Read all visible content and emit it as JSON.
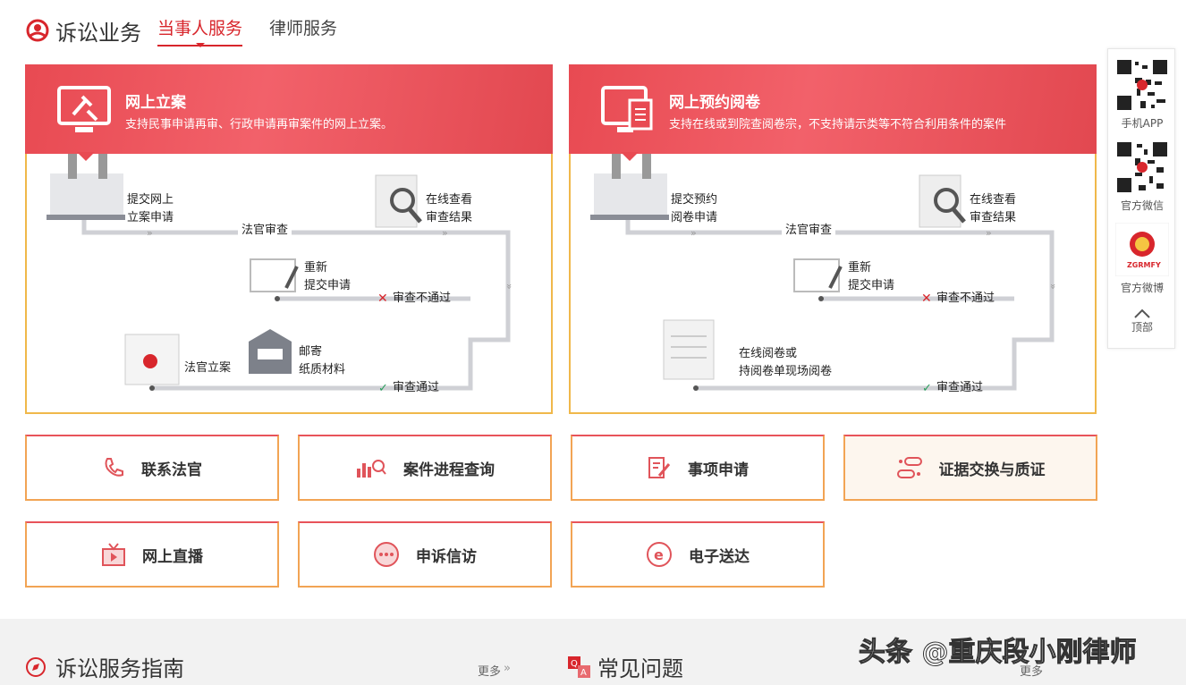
{
  "header": {
    "title": "诉讼业务",
    "tabs": [
      "当事人服务",
      "律师服务"
    ]
  },
  "panels": [
    {
      "title": "网上立案",
      "desc": "支持民事申请再审、行政申请再审案件的网上立案。",
      "steps": {
        "submit": "提交网上\n立案申请",
        "review": "法官审查",
        "view": "在线查看\n审查结果",
        "resubmit": "重新\n提交申请",
        "fail": "审查不通过",
        "register": "法官立案",
        "mail": "邮寄\n纸质材料",
        "pass": "审查通过"
      }
    },
    {
      "title": "网上预约阅卷",
      "desc": "支持在线或到院查阅卷宗，不支持请示类等不符合利用条件的案件",
      "steps": {
        "submit": "提交预约\n阅卷申请",
        "review": "法官审查",
        "view": "在线查看\n审查结果",
        "resubmit": "重新\n提交申请",
        "fail": "审查不通过",
        "read": "在线阅卷或\n持阅卷单现场阅卷",
        "pass": "审查通过"
      }
    }
  ],
  "services": [
    "联系法官",
    "案件进程查询",
    "事项申请",
    "证据交换与质证",
    "网上直播",
    "申诉信访",
    "电子送达"
  ],
  "sidebar": {
    "app": "手机APP",
    "wechat": "官方微信",
    "weibo": "官方微博",
    "top": "顶部",
    "emblem": "ZGRMFY"
  },
  "bottom": {
    "guide": "诉讼服务指南",
    "faq": "常见问题",
    "more": "更多"
  },
  "watermark": "头条 @重庆段小刚律师",
  "colors": {
    "accent": "#d8262c",
    "border": "#f2a454"
  }
}
